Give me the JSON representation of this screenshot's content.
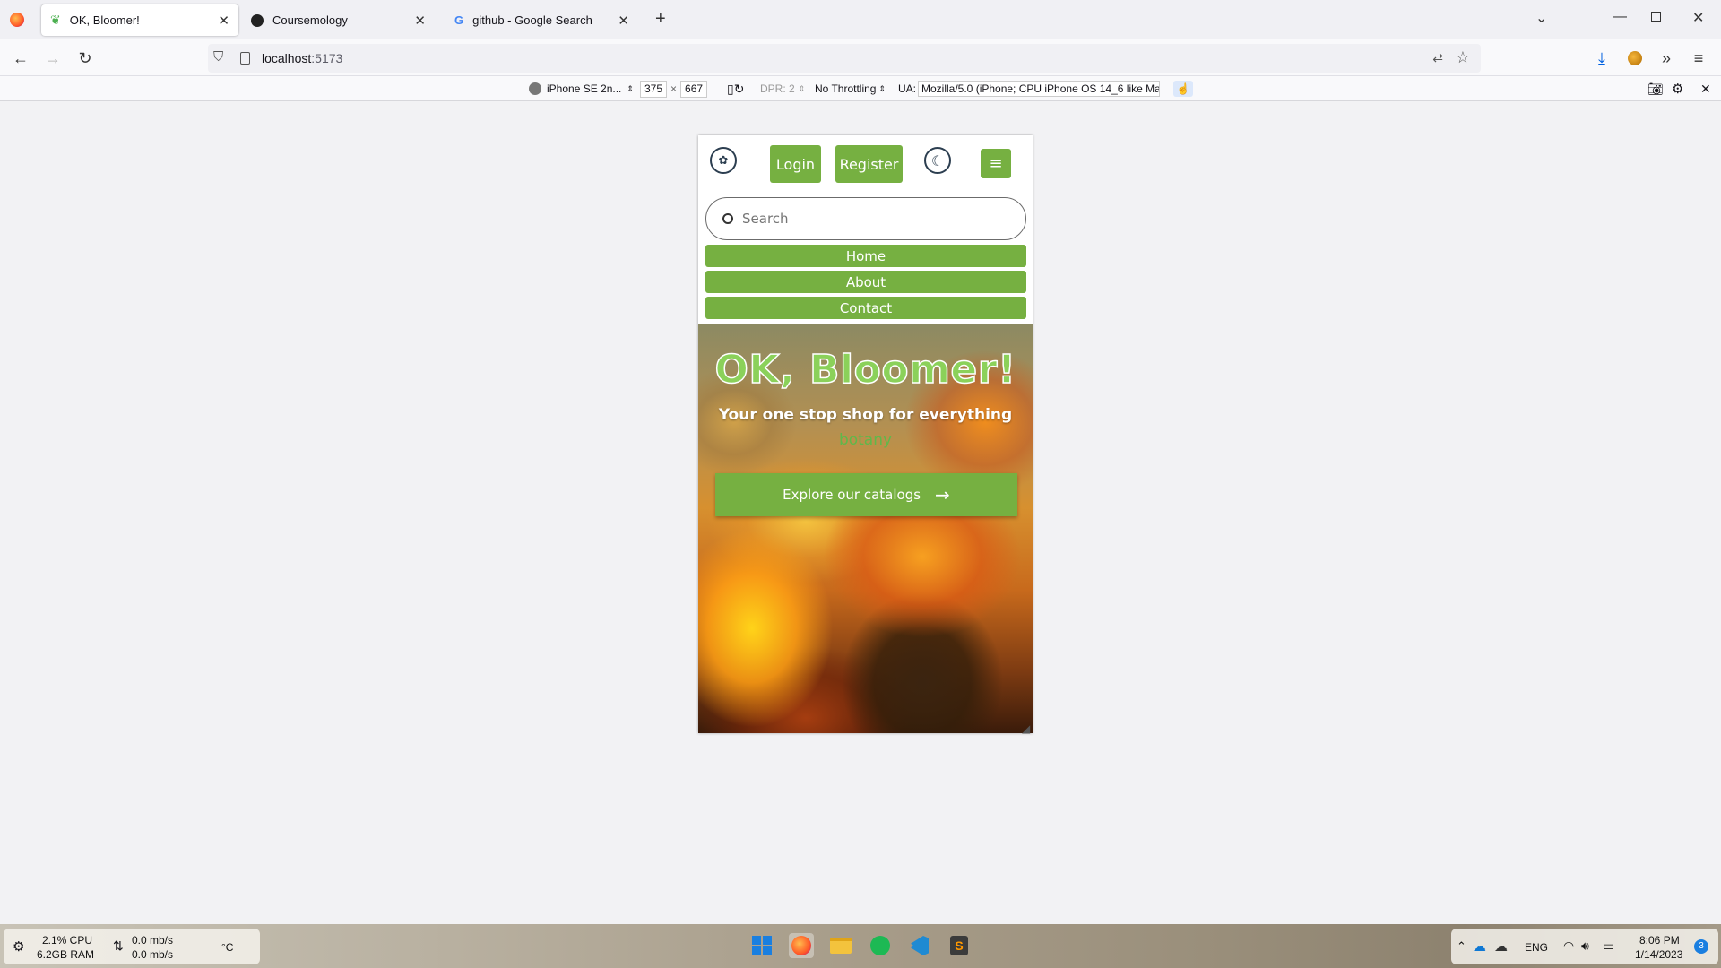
{
  "browser": {
    "tabs": [
      {
        "title": "OK, Bloomer!",
        "active": true
      },
      {
        "title": "Coursemology",
        "active": false
      },
      {
        "title": "github - Google Search",
        "active": false
      }
    ],
    "url_host": "localhost",
    "url_port": ":5173"
  },
  "rdm": {
    "device": "iPhone SE 2n...",
    "width": "375",
    "times": "×",
    "height": "667",
    "dpr": "DPR: 2",
    "throttling": "No Throttling",
    "ua_label": "UA:",
    "ua_value": "Mozilla/5.0 (iPhone; CPU iPhone OS 14_6 like Mac"
  },
  "app": {
    "login": "Login",
    "register": "Register",
    "menu_glyph": "≡",
    "search_placeholder": "Search",
    "nav": [
      "Home",
      "About",
      "Contact"
    ],
    "hero_title": "OK, Bloomer!",
    "hero_subtitle_1": "Your one stop shop for everything",
    "hero_subtitle_2": "botany",
    "cta": "Explore our catalogs",
    "accent": "#76b041"
  },
  "taskbar": {
    "cpu": "2.1% CPU",
    "ram": "6.2GB RAM",
    "net_up": "0.0 mb/s",
    "net_down": "0.0 mb/s",
    "temp": "°C",
    "lang": "ENG",
    "time": "8:06 PM",
    "date": "1/14/2023",
    "notif_count": "3"
  }
}
